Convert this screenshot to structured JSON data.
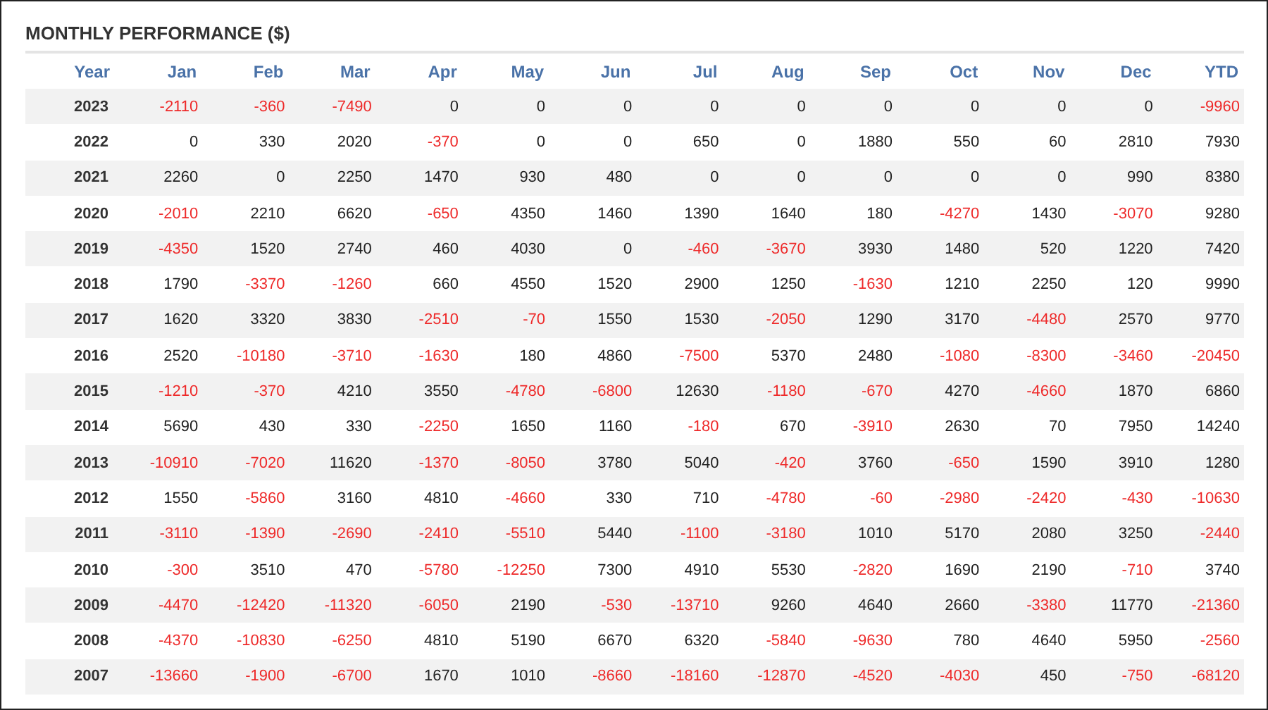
{
  "title": "MONTHLY PERFORMANCE ($)",
  "columns": [
    "Year",
    "Jan",
    "Feb",
    "Mar",
    "Apr",
    "May",
    "Jun",
    "Jul",
    "Aug",
    "Sep",
    "Oct",
    "Nov",
    "Dec",
    "YTD"
  ],
  "rows": [
    {
      "year": "2023",
      "values": [
        "-2110",
        "-360",
        "-7490",
        "0",
        "0",
        "0",
        "0",
        "0",
        "0",
        "0",
        "0",
        "0",
        "-9960"
      ],
      "negative": [
        true,
        true,
        true,
        false,
        false,
        false,
        false,
        false,
        false,
        false,
        false,
        false,
        true
      ]
    },
    {
      "year": "2022",
      "values": [
        "0",
        "330",
        "2020",
        "-370",
        "0",
        "0",
        "650",
        "0",
        "1880",
        "550",
        "60",
        "2810",
        "7930"
      ],
      "negative": [
        false,
        false,
        false,
        true,
        false,
        false,
        false,
        false,
        false,
        false,
        false,
        false,
        false
      ]
    },
    {
      "year": "2021",
      "values": [
        "2260",
        "0",
        "2250",
        "1470",
        "930",
        "480",
        "0",
        "0",
        "0",
        "0",
        "0",
        "990",
        "8380"
      ],
      "negative": [
        false,
        false,
        false,
        false,
        false,
        false,
        false,
        false,
        false,
        false,
        false,
        false,
        false
      ]
    },
    {
      "year": "2020",
      "values": [
        "-2010",
        "2210",
        "6620",
        "-650",
        "4350",
        "1460",
        "1390",
        "1640",
        "180",
        "-4270",
        "1430",
        "-3070",
        "9280"
      ],
      "negative": [
        true,
        false,
        false,
        true,
        false,
        false,
        false,
        false,
        false,
        true,
        false,
        true,
        false
      ]
    },
    {
      "year": "2019",
      "values": [
        "-4350",
        "1520",
        "2740",
        "460",
        "4030",
        "0",
        "-460",
        "-3670",
        "3930",
        "1480",
        "520",
        "1220",
        "7420"
      ],
      "negative": [
        true,
        false,
        false,
        false,
        false,
        false,
        true,
        true,
        false,
        false,
        false,
        false,
        false
      ]
    },
    {
      "year": "2018",
      "values": [
        "1790",
        "-3370",
        "-1260",
        "660",
        "4550",
        "1520",
        "2900",
        "1250",
        "-1630",
        "1210",
        "2250",
        "120",
        "9990"
      ],
      "negative": [
        false,
        true,
        true,
        false,
        false,
        false,
        false,
        false,
        true,
        false,
        false,
        false,
        false
      ]
    },
    {
      "year": "2017",
      "values": [
        "1620",
        "3320",
        "3830",
        "-2510",
        "-70",
        "1550",
        "1530",
        "-2050",
        "1290",
        "3170",
        "-4480",
        "2570",
        "9770"
      ],
      "negative": [
        false,
        false,
        false,
        true,
        true,
        false,
        false,
        true,
        false,
        false,
        true,
        false,
        false
      ]
    },
    {
      "year": "2016",
      "values": [
        "2520",
        "-10180",
        "-3710",
        "-1630",
        "180",
        "4860",
        "-7500",
        "5370",
        "2480",
        "-1080",
        "-8300",
        "-3460",
        "-20450"
      ],
      "negative": [
        false,
        true,
        true,
        true,
        false,
        false,
        true,
        false,
        false,
        true,
        true,
        true,
        true
      ]
    },
    {
      "year": "2015",
      "values": [
        "-1210",
        "-370",
        "4210",
        "3550",
        "-4780",
        "-6800",
        "12630",
        "-1180",
        "-670",
        "4270",
        "-4660",
        "1870",
        "6860"
      ],
      "negative": [
        true,
        true,
        false,
        false,
        true,
        true,
        false,
        true,
        true,
        false,
        true,
        false,
        false
      ]
    },
    {
      "year": "2014",
      "values": [
        "5690",
        "430",
        "330",
        "-2250",
        "1650",
        "1160",
        "-180",
        "670",
        "-3910",
        "2630",
        "70",
        "7950",
        "14240"
      ],
      "negative": [
        false,
        false,
        false,
        true,
        false,
        false,
        true,
        false,
        true,
        false,
        false,
        false,
        false
      ]
    },
    {
      "year": "2013",
      "values": [
        "-10910",
        "-7020",
        "11620",
        "-1370",
        "-8050",
        "3780",
        "5040",
        "-420",
        "3760",
        "-650",
        "1590",
        "3910",
        "1280"
      ],
      "negative": [
        true,
        true,
        false,
        true,
        true,
        false,
        false,
        true,
        false,
        true,
        false,
        false,
        false
      ]
    },
    {
      "year": "2012",
      "values": [
        "1550",
        "-5860",
        "3160",
        "4810",
        "-4660",
        "330",
        "710",
        "-4780",
        "-60",
        "-2980",
        "-2420",
        "-430",
        "-10630"
      ],
      "negative": [
        false,
        true,
        false,
        false,
        true,
        false,
        false,
        true,
        true,
        true,
        true,
        true,
        true
      ]
    },
    {
      "year": "2011",
      "values": [
        "-3110",
        "-1390",
        "-2690",
        "-2410",
        "-5510",
        "5440",
        "-1100",
        "-3180",
        "1010",
        "5170",
        "2080",
        "3250",
        "-2440"
      ],
      "negative": [
        true,
        true,
        true,
        true,
        true,
        false,
        true,
        true,
        false,
        false,
        false,
        false,
        true
      ]
    },
    {
      "year": "2010",
      "values": [
        "-300",
        "3510",
        "470",
        "-5780",
        "-12250",
        "7300",
        "4910",
        "5530",
        "-2820",
        "1690",
        "2190",
        "-710",
        "3740"
      ],
      "negative": [
        true,
        false,
        false,
        true,
        true,
        false,
        false,
        false,
        true,
        false,
        false,
        true,
        false
      ]
    },
    {
      "year": "2009",
      "values": [
        "-4470",
        "-12420",
        "-11320",
        "-6050",
        "2190",
        "-530",
        "-13710",
        "9260",
        "4640",
        "2660",
        "-3380",
        "11770",
        "-21360"
      ],
      "negative": [
        true,
        true,
        true,
        true,
        false,
        true,
        true,
        false,
        false,
        false,
        true,
        false,
        true
      ]
    },
    {
      "year": "2008",
      "values": [
        "-4370",
        "-10830",
        "-6250",
        "4810",
        "5190",
        "6670",
        "6320",
        "-5840",
        "-9630",
        "780",
        "4640",
        "5950",
        "-2560"
      ],
      "negative": [
        true,
        true,
        true,
        false,
        false,
        false,
        false,
        true,
        true,
        false,
        false,
        false,
        true
      ]
    },
    {
      "year": "2007",
      "values": [
        "-13660",
        "-1900",
        "-6700",
        "1670",
        "1010",
        "-8660",
        "-18160",
        "-12870",
        "-4520",
        "-4030",
        "450",
        "-750",
        "-68120"
      ],
      "negative": [
        true,
        true,
        true,
        false,
        false,
        true,
        true,
        true,
        true,
        true,
        false,
        true,
        true
      ]
    }
  ]
}
